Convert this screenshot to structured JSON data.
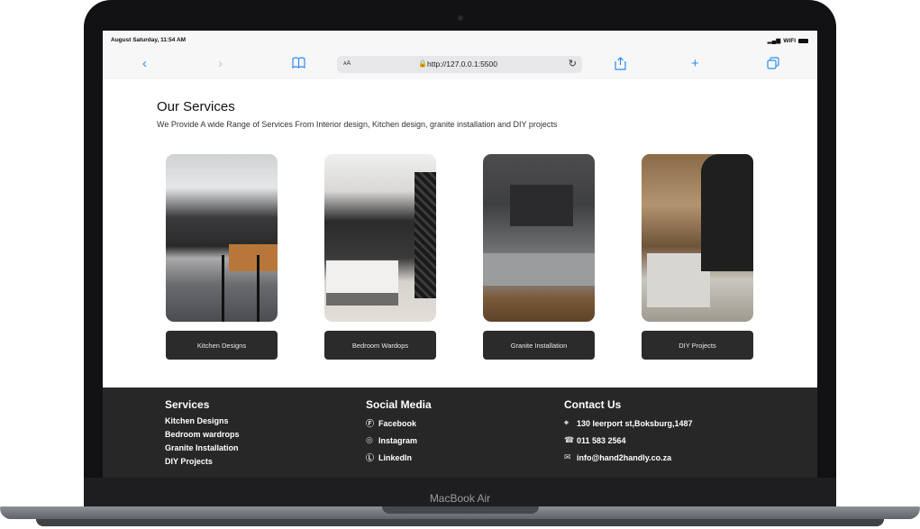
{
  "device": {
    "label": "MacBook Air"
  },
  "status_bar": {
    "time": "August Saturday, 11:54 AM",
    "signal": "▂▄▆",
    "wifi": "WIFI"
  },
  "browser": {
    "aa": "ᴀA",
    "url": "http://127.0.0.1:5500",
    "icons": [
      "back-icon",
      "forward-icon",
      "book-icon",
      "lock-icon",
      "reload-icon",
      "share-icon",
      "plus-icon",
      "tabs-icon"
    ]
  },
  "page": {
    "title": "Our Services",
    "subtitle": "We Provide A wide Range of Services From Interior design, Kitchen design, granite installation and DIY projects"
  },
  "services": [
    {
      "label": "Kitchen Designs"
    },
    {
      "label": "Bedroom Wardops"
    },
    {
      "label": "Granite Installation"
    },
    {
      "label": "DIY Projects"
    }
  ],
  "footer": {
    "services": {
      "heading": "Services",
      "items": [
        "Kitchen Designs",
        "Bedroom wardrops",
        "Granite Installation",
        "DIY Projects"
      ]
    },
    "social": {
      "heading": "Social Media",
      "items": [
        "Facebook",
        "Instagram",
        "LinkedIn"
      ]
    },
    "contact": {
      "heading": "Contact Us",
      "address": "130 leerport st,Boksburg,1487",
      "phone": "011 583 2564",
      "email": "info@hand2handly.co.za"
    }
  }
}
